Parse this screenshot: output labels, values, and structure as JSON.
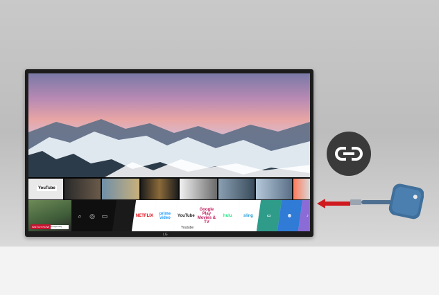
{
  "top_row": {
    "youtube_chip": "YouTube"
  },
  "hero": {
    "cta": "WATCH NOW",
    "badge": "Google Play"
  },
  "nav_icons": {
    "search": "⌕",
    "profile": "◎",
    "input": "▭",
    "recent": "⟲"
  },
  "app_tiles": [
    {
      "label": "",
      "style": "dark"
    },
    {
      "label": "NETFLIX",
      "color": "#e50914"
    },
    {
      "label": "prime video",
      "color": "#1a98ff"
    },
    {
      "label": "YouTube",
      "color": "#222222"
    },
    {
      "label": "Google Play Movies & TV",
      "color": "#c2185b"
    },
    {
      "label": "hulu",
      "color": "#1ce783"
    },
    {
      "label": "sling",
      "color": "#2b9fd9"
    },
    {
      "label": "▭",
      "style": "teal"
    },
    {
      "label": "◍",
      "style": "blue"
    },
    {
      "label": "♪",
      "style": "purple"
    }
  ],
  "launcher_label": "Youtube",
  "brand": "LG",
  "accessories": {
    "link_icon": "link-icon",
    "arrow_color": "#d0191f",
    "dongle_color": "#3a6f9c"
  }
}
